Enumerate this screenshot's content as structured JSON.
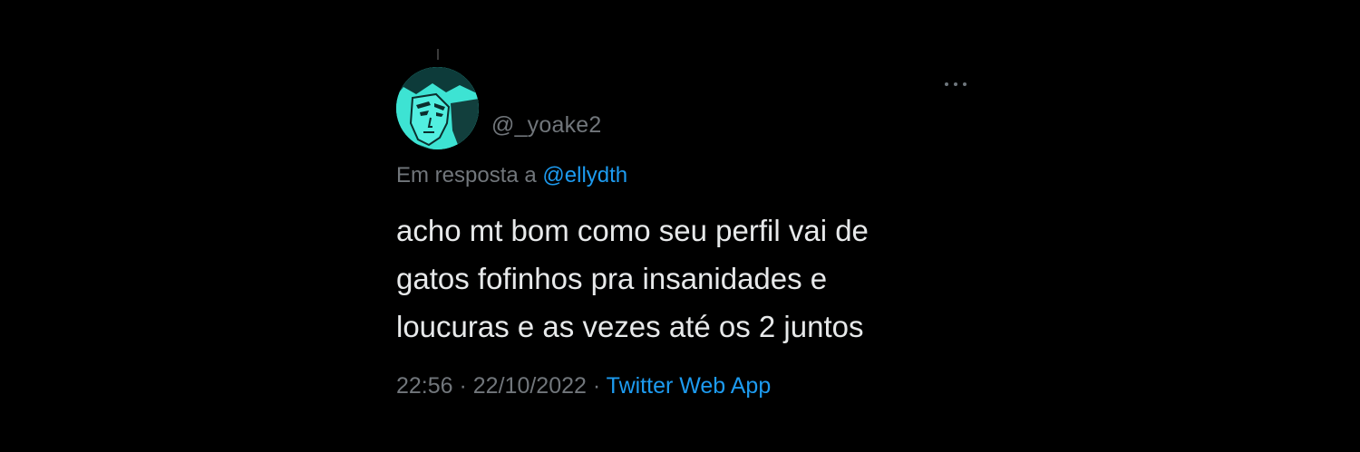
{
  "tweet": {
    "handle": "@_yoake2",
    "reply_prefix": "Em resposta a ",
    "reply_to": "@ellydth",
    "text_lines": [
      "acho mt bom como seu perfil vai de",
      "gatos fofinhos pra insanidades e",
      "loucuras e as vezes até os 2 juntos"
    ],
    "time": "22:56",
    "separator": " · ",
    "date": "22/10/2022",
    "source": "Twitter Web App"
  },
  "icons": {
    "more": "more-options-icon",
    "avatar": "avatar-anime-character"
  },
  "colors": {
    "background": "#000000",
    "primary_text": "#e7e9ea",
    "secondary_text": "#71767b",
    "link": "#1d9bf0",
    "avatar_bg": "#3de3d3"
  }
}
